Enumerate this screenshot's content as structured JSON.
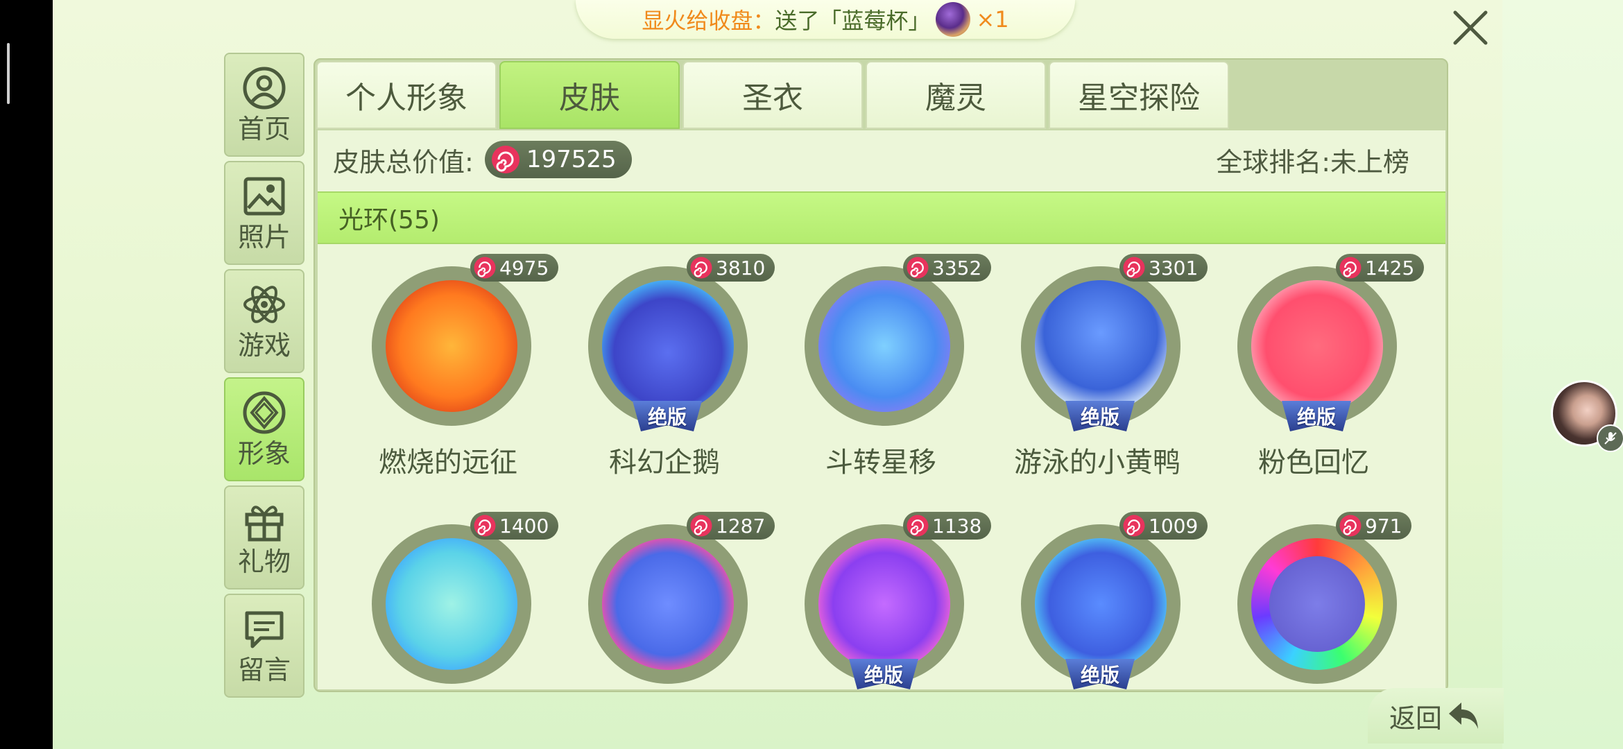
{
  "banner": {
    "prefix": "显火",
    "partial": "给收盘",
    "colon": "：",
    "action": "送了「蓝莓杯」",
    "count": "×1",
    "gift_icon": "blueberry-cup-icon"
  },
  "nav": [
    {
      "label": "首页",
      "icon": "user-icon"
    },
    {
      "label": "照片",
      "icon": "image-icon"
    },
    {
      "label": "游戏",
      "icon": "atom-icon"
    },
    {
      "label": "形象",
      "icon": "gem-icon",
      "active": true
    },
    {
      "label": "礼物",
      "icon": "gift-icon"
    },
    {
      "label": "留言",
      "icon": "message-icon"
    }
  ],
  "tabs": [
    {
      "label": "个人形象"
    },
    {
      "label": "皮肤",
      "active": true
    },
    {
      "label": "圣衣"
    },
    {
      "label": "魔灵"
    },
    {
      "label": "星空探险"
    }
  ],
  "summary": {
    "total_label": "皮肤总价值:",
    "total_value": "197525",
    "rank_label": "全球排名:未上榜"
  },
  "category": {
    "label": "光环(55)"
  },
  "items": [
    {
      "name": "燃烧的远征",
      "price": "4975",
      "badge": ""
    },
    {
      "name": "科幻企鹅",
      "price": "3810",
      "badge": "绝版"
    },
    {
      "name": "斗转星移",
      "price": "3352",
      "badge": ""
    },
    {
      "name": "游泳的小黄鸭",
      "price": "3301",
      "badge": "绝版"
    },
    {
      "name": "粉色回忆",
      "price": "1425",
      "badge": "绝版"
    },
    {
      "name": "",
      "price": "1400",
      "badge": ""
    },
    {
      "name": "",
      "price": "1287",
      "badge": ""
    },
    {
      "name": "",
      "price": "1138",
      "badge": "绝版"
    },
    {
      "name": "",
      "price": "1009",
      "badge": "绝版"
    },
    {
      "name": "",
      "price": "971",
      "badge": ""
    }
  ],
  "back": {
    "label": "返回"
  },
  "colors": {
    "accent_green": "#b4ec6f",
    "panel": "#ecf6d9",
    "pill": "#55644a",
    "badge_blue": "#2b3f8f"
  }
}
